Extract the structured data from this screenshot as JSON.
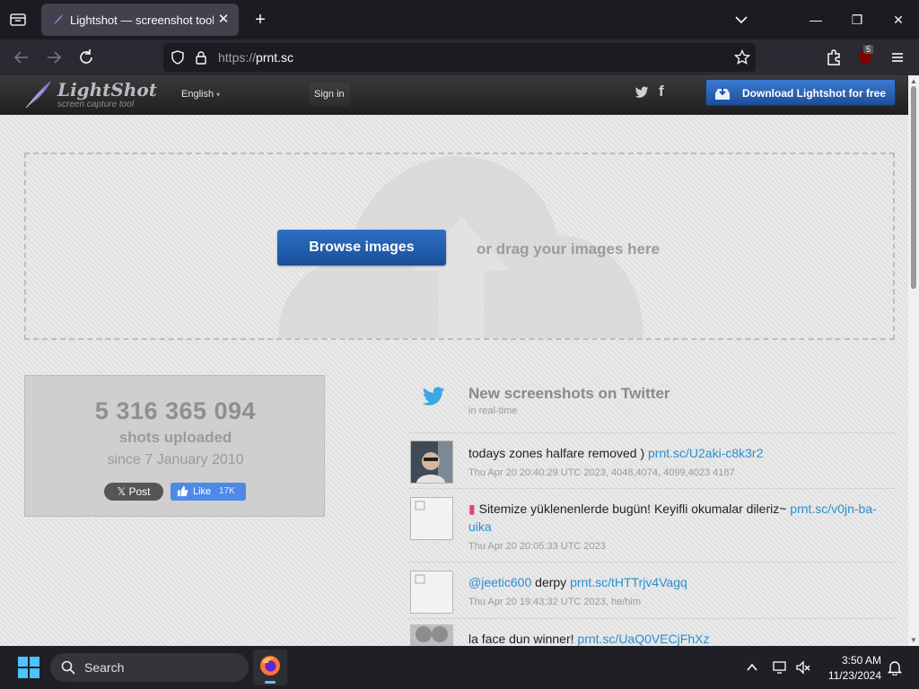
{
  "browser": {
    "tab_title": "Lightshot — screenshot tool for Mac & Win",
    "url_scheme": "https://",
    "url_host": "prnt.sc",
    "extension_badge": "5"
  },
  "site": {
    "logo_title": "LightShot",
    "logo_subtitle": "screen capture tool",
    "language": "English",
    "signin": "Sign in",
    "download_label": "Download Lightshot for free"
  },
  "upload": {
    "browse_label": "Browse images",
    "drag_text": "or drag your images here"
  },
  "stats": {
    "count": "5 316 365 094",
    "label": "shots uploaded",
    "since": "since 7 January 2010",
    "post_label": "Post",
    "like_label": "Like",
    "like_count": "17K"
  },
  "twitter": {
    "title": "New screenshots on Twitter",
    "subtitle": "in real-time",
    "items": [
      {
        "text": "todays zones halfare removed )",
        "link": "prnt.sc/U2aki-c8k3r2",
        "meta": "Thu Apr 20 20:40:29 UTC 2023, 4048,4074, 4099,4023 4187"
      },
      {
        "text": "Sitemize yüklenenlerde bugün! Keyifli okumalar dileriz~",
        "link": "prnt.sc/v0jn-ba-uika",
        "meta": "Thu Apr 20 20:05:33 UTC 2023"
      },
      {
        "mention": "@jeetic600",
        "text": "derpy",
        "link": "prnt.sc/tHTTrjv4Vagq",
        "meta": "Thu Apr 20 19:43:32 UTC 2023, he/him"
      },
      {
        "text": "la face dun winner!",
        "link": "prnt.sc/UaQ0VECjFhXz",
        "meta": ""
      }
    ]
  },
  "taskbar": {
    "search_label": "Search",
    "time": "3:50 AM",
    "date": "11/23/2024"
  }
}
